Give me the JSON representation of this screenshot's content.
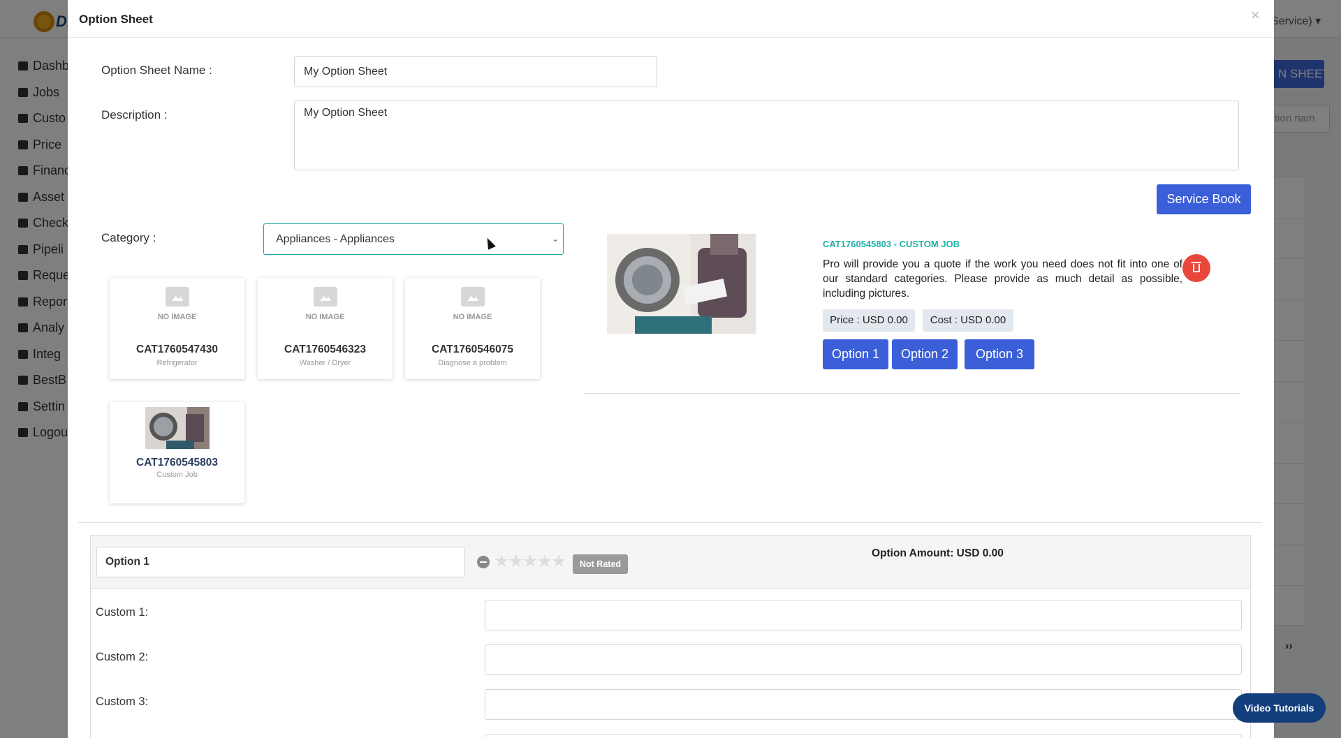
{
  "app": {
    "logo_text": "Di",
    "user_text": "Service)",
    "nav": [
      "Dashb",
      "Jobs",
      "Custo",
      "Price",
      "Financ",
      "Asset",
      "Check",
      "Pipeli",
      "Reque",
      "Repor",
      "Analy",
      "Integ",
      "BestB",
      "Settin",
      "Logou"
    ],
    "right_button_label": "N SHEET",
    "right_search_placeholder": "tion nam",
    "pager_next": "››"
  },
  "modal": {
    "title": "Option Sheet",
    "close": "×",
    "name_label": "Option Sheet Name :",
    "name_value": "My Option Sheet",
    "description_label": "Description :",
    "description_value": "My Option Sheet",
    "service_book_label": "Service Book",
    "category_label": "Category :",
    "category_value": "Appliances - Appliances",
    "no_image_text": "NO IMAGE",
    "cards": [
      {
        "code": "CAT1760547430",
        "name": "Refrigerator"
      },
      {
        "code": "CAT1760546323",
        "name": "Washer / Dryer"
      },
      {
        "code": "CAT1760546075",
        "name": "Diagnose a problem"
      },
      {
        "code": "CAT1760545803",
        "name": "Custom Job"
      }
    ],
    "detail": {
      "code_title": "CAT1760545803 - CUSTOM JOB",
      "description": "Pro will provide you a quote if the work you need does not fit into one of our standard categories. Please provide as much detail as possible, including pictures.",
      "price": "Price : USD 0.00",
      "cost": "Cost : USD 0.00",
      "options": [
        "Option 1",
        "Option 2",
        "Option 3"
      ]
    },
    "option_panel": {
      "name_value": "Option 1",
      "rating_stars": 0,
      "rating_label": "Not Rated",
      "amount": "Option Amount: USD 0.00",
      "custom_labels": [
        "Custom 1:",
        "Custom 2:",
        "Custom 3:"
      ]
    }
  },
  "video_tutorials_label": "Video Tutorials",
  "colors": {
    "primary": "#3b5fd8",
    "teal": "#20b2aa",
    "danger": "#e9473c",
    "navy": "#123e7e"
  }
}
